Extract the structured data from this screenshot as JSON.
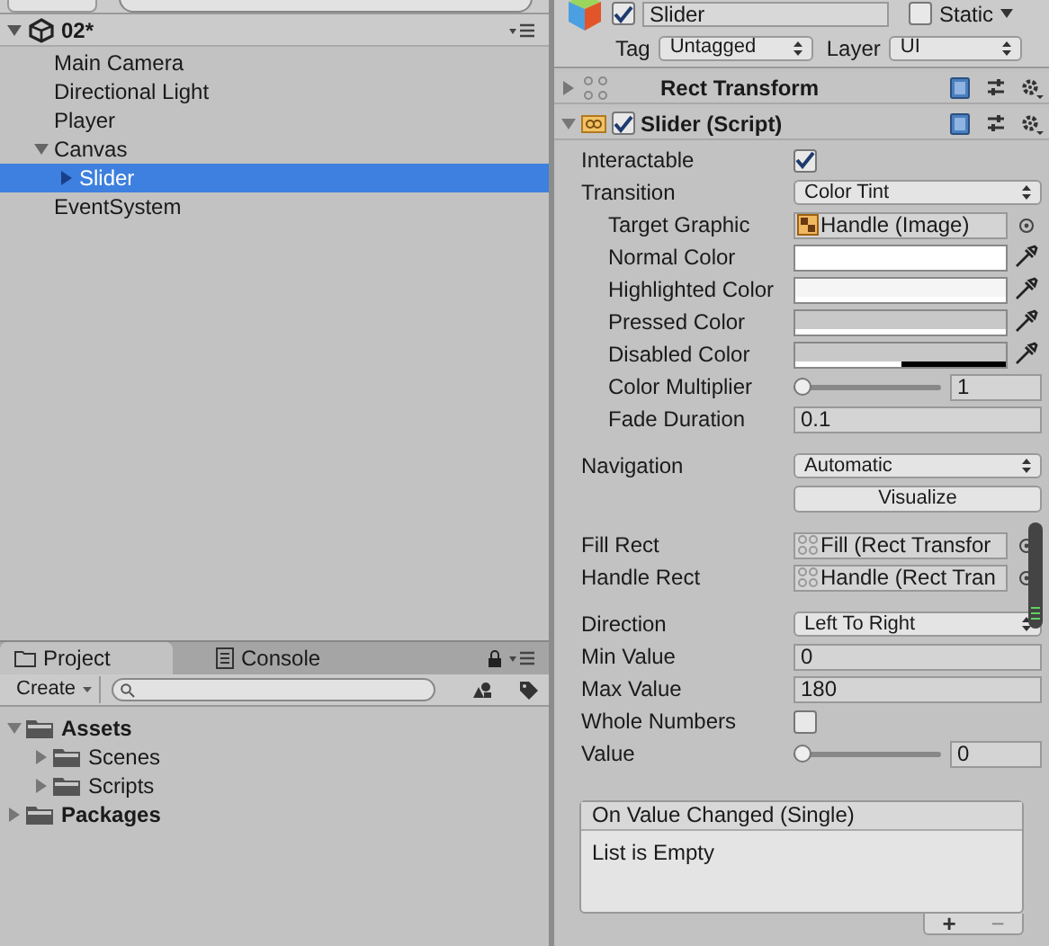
{
  "hierarchy": {
    "scene": "02*",
    "items": [
      {
        "label": "Main Camera",
        "selected": false
      },
      {
        "label": "Directional Light",
        "selected": false
      },
      {
        "label": "Player",
        "selected": false
      },
      {
        "label": "Canvas",
        "selected": false,
        "expanded": true,
        "children": [
          {
            "label": "Slider",
            "selected": true,
            "expanded": false
          }
        ]
      },
      {
        "label": "EventSystem",
        "selected": false
      }
    ]
  },
  "project": {
    "tabs": [
      {
        "label": "Project",
        "selected": true,
        "kind": "folder"
      },
      {
        "label": "Console",
        "selected": false,
        "kind": "console"
      }
    ],
    "create": "Create",
    "items": [
      {
        "label": "Assets",
        "expanded": true,
        "children": [
          {
            "label": "Scenes",
            "expanded": false
          },
          {
            "label": "Scripts",
            "expanded": false
          }
        ]
      },
      {
        "label": "Packages",
        "expanded": false
      }
    ]
  },
  "inspector": {
    "active": true,
    "name": "Slider",
    "static": false,
    "static_label": "Static",
    "tag_label": "Tag",
    "tag": "Untagged",
    "layer_label": "Layer",
    "layer": "UI",
    "components": [
      {
        "title": "Rect Transform",
        "expanded": false,
        "kind": "rect"
      },
      {
        "title": "Slider (Script)",
        "expanded": true,
        "enabled": true,
        "kind": "script"
      }
    ],
    "sections": [
      {
        "fields": [
          {
            "kind": "checkbox",
            "label": "Interactable",
            "checked": true
          },
          {
            "kind": "dropdown",
            "label": "Transition",
            "value": "Color Tint",
            "children": [
              {
                "kind": "image_object",
                "label": "Target Graphic",
                "value": "Handle (Image)"
              },
              {
                "kind": "color",
                "label": "Normal Color",
                "color": "#ffffff",
                "level": 1
              },
              {
                "kind": "color",
                "label": "Highlighted Color",
                "color": "#f5f5f5",
                "level": 1
              },
              {
                "kind": "color",
                "label": "Pressed Color",
                "color": "#c8c8c8",
                "level": 1
              },
              {
                "kind": "color",
                "label": "Disabled Color",
                "color": "#c8c8c8",
                "level": 0.5
              },
              {
                "kind": "slider",
                "label": "Color Multiplier",
                "value": "1",
                "level": 0
              },
              {
                "kind": "text",
                "label": "Fade Duration",
                "value": "0.1"
              }
            ]
          }
        ]
      },
      {
        "fields": [
          {
            "kind": "dropdown",
            "label": "Navigation",
            "value": "Automatic"
          },
          {
            "kind": "button",
            "value": "Visualize"
          }
        ]
      },
      {
        "fields": [
          {
            "kind": "rect_object",
            "label": "Fill Rect",
            "value": "Fill (Rect Transfor"
          },
          {
            "kind": "rect_object",
            "label": "Handle Rect",
            "value": "Handle (Rect Tran"
          }
        ]
      },
      {
        "fields": [
          {
            "kind": "dropdown",
            "label": "Direction",
            "value": "Left To Right"
          },
          {
            "kind": "text",
            "label": "Min Value",
            "value": "0"
          },
          {
            "kind": "text",
            "label": "Max Value",
            "value": "180"
          },
          {
            "kind": "checkbox",
            "label": "Whole Numbers",
            "checked": false
          },
          {
            "kind": "slider",
            "label": "Value",
            "value": "0",
            "level": 0
          }
        ]
      }
    ],
    "event": {
      "title": "On Value Changed (Single)",
      "empty": "List is Empty",
      "add": "+",
      "remove": "−"
    }
  }
}
